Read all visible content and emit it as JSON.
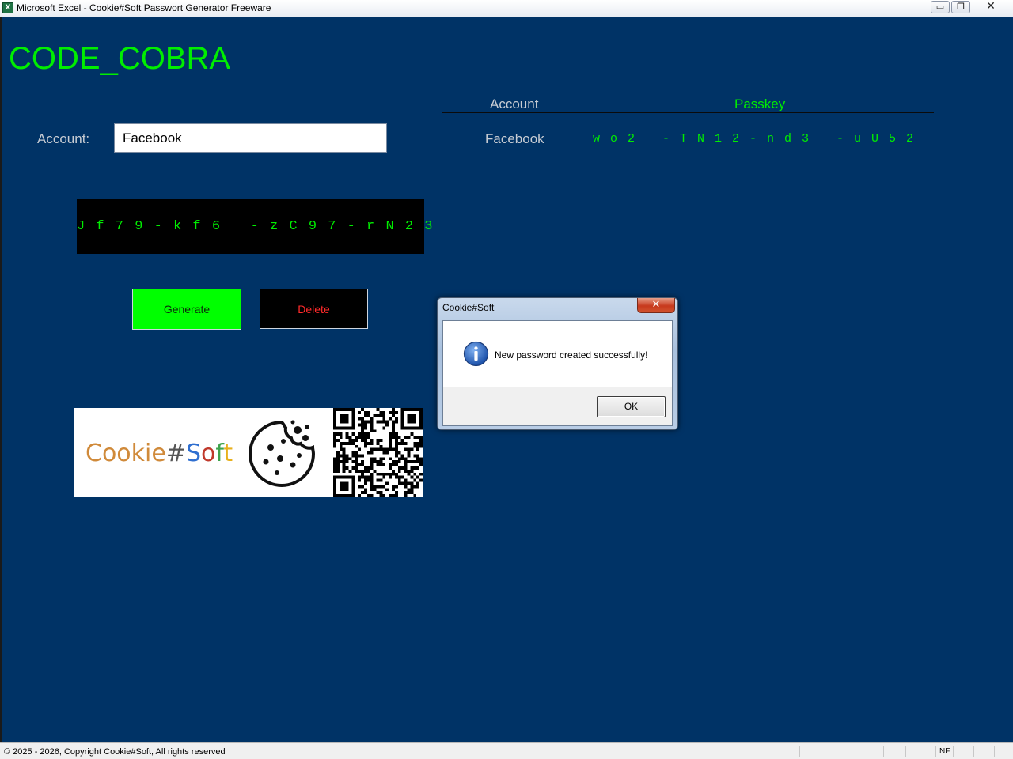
{
  "window": {
    "title": "Microsoft Excel - Cookie#Soft Passwort Generator Freeware",
    "app_icon": "excel-icon",
    "controls": {
      "minimize": "▭",
      "restore": "❐",
      "close": "✕"
    }
  },
  "app": {
    "name": "CODE_COBRA",
    "colors": {
      "background": "#003366",
      "accent": "#00ee00",
      "danger": "#ff2a2a"
    }
  },
  "form": {
    "account_label": "Account:",
    "account_value": "Facebook"
  },
  "generated_password": "J f 7 9 - k f 6   - z C 9 7 - r N 2 3",
  "buttons": {
    "generate": "Generate",
    "delete": "Delete"
  },
  "table": {
    "headers": {
      "account": "Account",
      "passkey": "Passkey"
    },
    "rows": [
      {
        "account": "Facebook",
        "passkey": "w o 2   - T N 1 2 - n d 3   - u U 5 2"
      }
    ]
  },
  "banner": {
    "brand_parts": [
      {
        "text": "Cookie",
        "color": "#d08a3a"
      },
      {
        "text": "#",
        "color": "#555555"
      },
      {
        "text": "S",
        "color": "#2f6fd0"
      },
      {
        "text": "o",
        "color": "#c0392b"
      },
      {
        "text": "f",
        "color": "#3fa34d"
      },
      {
        "text": "t",
        "color": "#e8b01c"
      }
    ],
    "icons": [
      "cookie-icon",
      "qr-code"
    ]
  },
  "dialog": {
    "title": "Cookie#Soft",
    "message": "New password created successfully!",
    "ok_label": "OK",
    "close_glyph": "✕",
    "icon": "info-icon"
  },
  "statusbar": {
    "text": "© 2025 - 2026, Copyright Cookie#Soft, All rights reserved",
    "indicator": "NF"
  }
}
